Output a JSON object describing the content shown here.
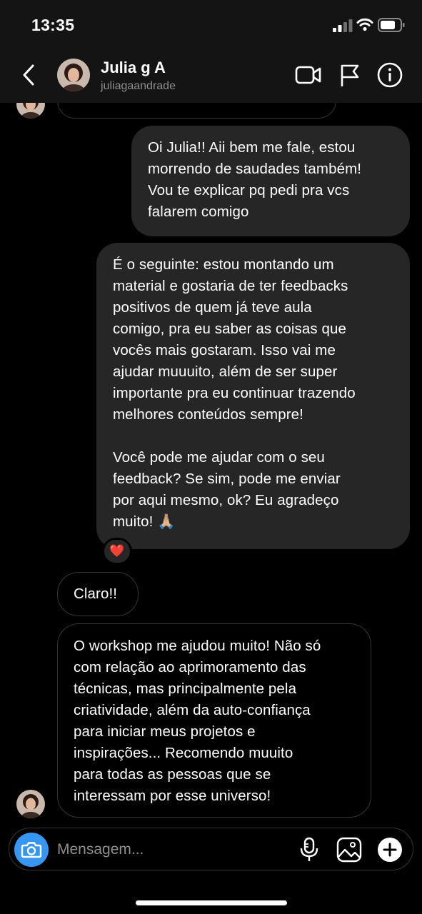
{
  "status_bar": {
    "time": "13:35",
    "icons": [
      "cellular-signal-icon",
      "wifi-icon",
      "battery-icon"
    ]
  },
  "header": {
    "back_icon": "chevron-left-icon",
    "contact_name": "Julia g A",
    "contact_username": "juliagaandrade",
    "actions": [
      "video-camera-icon",
      "flag-icon",
      "info-icon"
    ]
  },
  "messages": [
    {
      "direction": "outgoing",
      "text": "Oi Julia!! Aii bem me fale, estou\nmorrendo de saudades também!\nVou te explicar pq pedi pra vcs\nfalarem comigo"
    },
    {
      "direction": "outgoing",
      "text": "É o seguinte: estou montando um\nmaterial e gostaria de ter feedbacks\npositivos de quem já teve aula\ncomigo, pra eu saber as coisas que\nvocês mais gostaram. Isso vai me\najudar muuuito, além de ser super\nimportante pra eu continuar trazendo\nmelhores conteúdos sempre!\n\nVocê pode me ajudar com o seu\nfeedback? Se sim, pode me enviar\npor aqui mesmo, ok? Eu agradeço\nmuito! 🙏🏼",
      "reaction": "❤️"
    },
    {
      "direction": "incoming",
      "text": "Claro!!"
    },
    {
      "direction": "incoming",
      "text": "O workshop me ajudou muito! Não só\ncom relação ao aprimoramento das\ntécnicas, mas principalmente pela\ncriatividade, além da auto-confiança\npara iniciar meus projetos e\ninspirações... Recomendo muuito\npara todas as pessoas que se\ninteressam por esse universo!"
    }
  ],
  "composer": {
    "placeholder": "Mensagem...",
    "icons": [
      "camera-icon",
      "microphone-icon",
      "gallery-icon",
      "plus-icon"
    ]
  },
  "colors": {
    "background": "#000000",
    "bar": "#141414",
    "outgoing_bubble": "#262626",
    "incoming_border": "#363636",
    "camera_button": "#3797f0",
    "muted_text": "#8e8e8e"
  }
}
